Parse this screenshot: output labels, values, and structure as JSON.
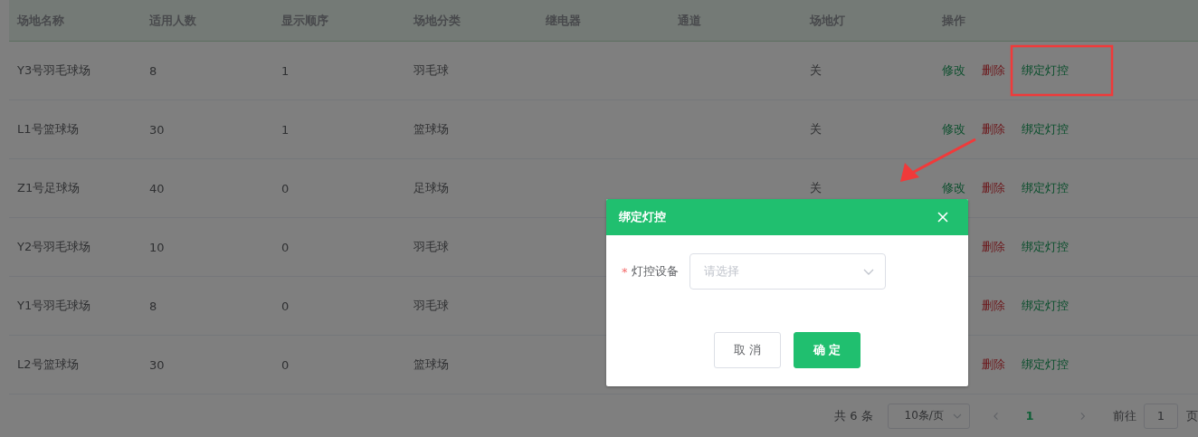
{
  "table": {
    "columns": [
      "场地名称",
      "适用人数",
      "显示顺序",
      "场地分类",
      "继电器",
      "通道",
      "场地灯",
      "操作"
    ],
    "rows": [
      {
        "name": "Y3号羽毛球场",
        "capacity": "8",
        "order": "1",
        "category": "羽毛球",
        "lamp": "关",
        "actions": [
          {
            "kind": "edit",
            "label": "修改"
          },
          {
            "kind": "delete",
            "label": "删除"
          },
          {
            "kind": "bind",
            "label": "绑定灯控"
          }
        ]
      },
      {
        "name": "L1号篮球场",
        "capacity": "30",
        "order": "1",
        "category": "篮球场",
        "lamp": "关",
        "actions": [
          {
            "kind": "edit",
            "label": "修改"
          },
          {
            "kind": "delete",
            "label": "删除"
          },
          {
            "kind": "bind",
            "label": "绑定灯控"
          }
        ]
      },
      {
        "name": "Z1号足球场",
        "capacity": "40",
        "order": "0",
        "category": "足球场",
        "lamp": "关",
        "actions": [
          {
            "kind": "edit",
            "label": "修改"
          },
          {
            "kind": "delete",
            "label": "删除"
          },
          {
            "kind": "bind",
            "label": "绑定灯控"
          }
        ]
      },
      {
        "name": "Y2号羽毛球场",
        "capacity": "10",
        "order": "0",
        "category": "羽毛球",
        "actions": [
          {
            "kind": "delete",
            "label": "删除"
          },
          {
            "kind": "bind",
            "label": "绑定灯控"
          }
        ]
      },
      {
        "name": "Y1号羽毛球场",
        "capacity": "8",
        "order": "0",
        "category": "羽毛球",
        "actions": [
          {
            "kind": "delete",
            "label": "删除"
          },
          {
            "kind": "bind",
            "label": "绑定灯控"
          }
        ]
      },
      {
        "name": "L2号篮球场",
        "capacity": "30",
        "order": "0",
        "category": "篮球场",
        "actions": [
          {
            "kind": "delete",
            "label": "删除"
          },
          {
            "kind": "bind",
            "label": "绑定灯控"
          }
        ]
      }
    ]
  },
  "pagination": {
    "total": "共 6 条",
    "page_size": "10条/页",
    "pages": [
      {
        "label": "1",
        "selected": true
      }
    ],
    "goto_label": "前往",
    "goto_value": "1",
    "goto_suffix": "页"
  },
  "dialog": {
    "title": "绑定灯控",
    "field_label": "灯控设备",
    "required_mark": "*",
    "placeholder": "请选择",
    "buttons": [
      {
        "kind": "secondary",
        "label": "取 消"
      },
      {
        "kind": "primary",
        "label": "确 定"
      }
    ]
  }
}
